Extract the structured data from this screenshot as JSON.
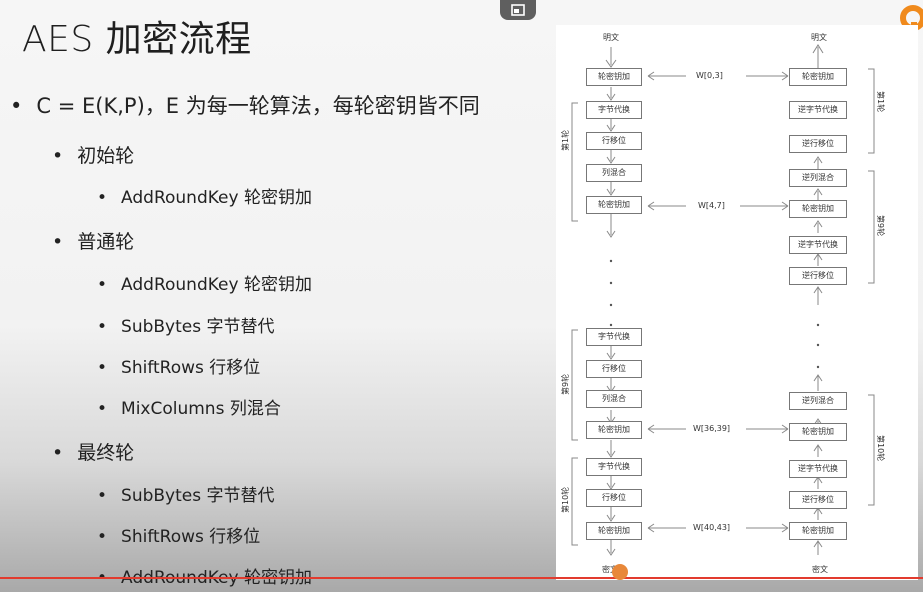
{
  "slide": {
    "title": "AES 加密流程",
    "bullets": [
      "C = E(K,P)，E 为每一轮算法，每轮密钥皆不同",
      "初始轮",
      "AddRoundKey 轮密钥加",
      "普通轮",
      "AddRoundKey 轮密钥加",
      "SubBytes 字节替代",
      "ShiftRows 行移位",
      "MixColumns 列混合",
      "最终轮",
      "SubBytes 字节替代",
      "ShiftRows 行移位",
      "AddRoundKey 轮密钥加"
    ]
  },
  "diagram": {
    "left_top": "明文",
    "right_top": "明文",
    "left_bottom": "密文",
    "right_bottom": "密文",
    "left_boxes": [
      "轮密钥加",
      "字节代换",
      "行移位",
      "列混合",
      "轮密钥加",
      "字节代换",
      "行移位",
      "列混合",
      "轮密钥加",
      "字节代换",
      "行移位",
      "轮密钥加"
    ],
    "right_boxes": [
      "轮密钥加",
      "逆字节代换",
      "逆行移位",
      "逆列混合",
      "轮密钥加",
      "逆字节代换",
      "逆行移位",
      "逆列混合",
      "轮密钥加",
      "逆字节代换",
      "逆行移位",
      "轮密钥加"
    ],
    "keys": [
      "W[0,3]",
      "W[4,7]",
      "W[36,39]",
      "W[40,43]"
    ],
    "round_labels": [
      "第1轮",
      "第9轮",
      "第10轮",
      "第1轮",
      "第9轮",
      "第10轮"
    ]
  },
  "colors": {
    "accent_line": "#e23b2e",
    "cursor": "#e8883a"
  }
}
